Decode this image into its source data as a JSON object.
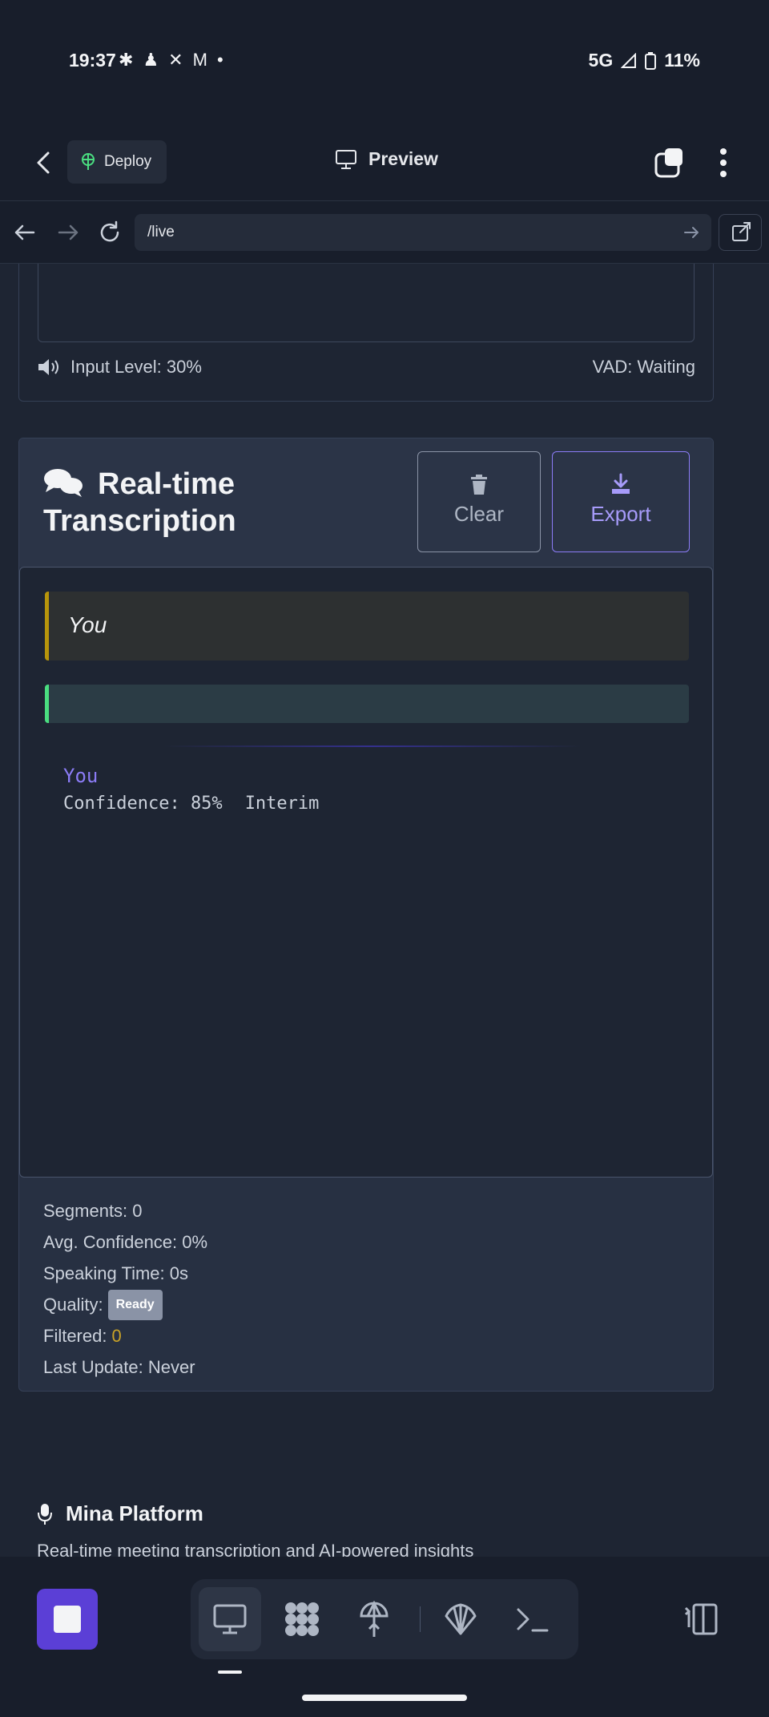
{
  "status_bar": {
    "time": "19:37",
    "notif_icons": [
      "slack-icon",
      "snapchat-icon",
      "x-icon",
      "gmail-icon",
      "dot-icon"
    ],
    "network": "5G",
    "battery": "11%"
  },
  "app_header": {
    "deploy_label": "Deploy",
    "preview_label": "Preview"
  },
  "browser": {
    "url": "/live"
  },
  "audio_panel": {
    "input_level_label": "Input Level: 30%",
    "vad_label": "VAD: Waiting"
  },
  "transcription": {
    "title": "Real-time Transcription",
    "clear_label": "Clear",
    "export_label": "Export",
    "segment_speaker": "You",
    "interim_speaker": "You",
    "confidence": "Confidence: 85%",
    "status": "Interim"
  },
  "stats": {
    "segments": "Segments: 0",
    "avg_confidence": "Avg. Confidence: 0%",
    "speaking_time": "Speaking Time: 0s",
    "quality_label": "Quality:",
    "quality_badge": "Ready",
    "filtered_label": "Filtered:",
    "filtered_value": "0",
    "last_update": "Last Update: Never"
  },
  "footer": {
    "title": "Mina Platform",
    "subtitle": "Real-time meeting transcription and AI-powered insights"
  },
  "colors": {
    "accent": "#8b7cf6",
    "stop_button": "#5b3fd6",
    "interim_border": "#b7950b",
    "final_border": "#4ade80"
  }
}
